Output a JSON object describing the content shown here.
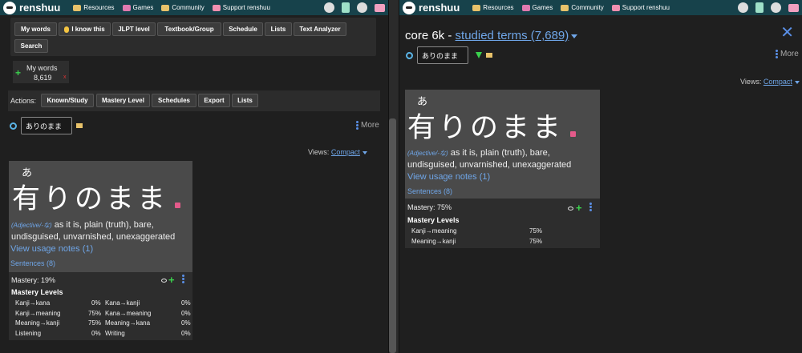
{
  "nav": {
    "brand": "renshuu",
    "links": [
      "Resources",
      "Games",
      "Community",
      "Support renshuu"
    ]
  },
  "left": {
    "toolbar": [
      "My words",
      "I know this",
      "JLPT level",
      "Textbook/Group",
      "Schedule",
      "Lists",
      "Text Analyzer",
      "Search"
    ],
    "mywords": {
      "label": "My words",
      "count": "8,619",
      "remove": "x"
    },
    "actions": {
      "label": "Actions:",
      "buttons": [
        "Known/Study",
        "Mastery Level",
        "Schedules",
        "Export",
        "Lists"
      ]
    },
    "search_value": "ありのまま",
    "more": "More",
    "views_label": "Views:",
    "views_value": "Compact",
    "card": {
      "furigana": "あ",
      "word": "有りのまま",
      "pos": "(Adjective/-な)",
      "definition": "as it is, plain (truth), bare, undisguised, unvarnished, unexaggerated",
      "usage": "View usage notes (1)",
      "sentences": "Sentences (8)",
      "mastery": "Mastery: 19%",
      "levels_title": "Mastery Levels",
      "levels": [
        {
          "name": "Kanji→kana",
          "value": "0%"
        },
        {
          "name": "Kana→kanji",
          "value": "0%"
        },
        {
          "name": "Kanji→meaning",
          "value": "75%"
        },
        {
          "name": "Kana→meaning",
          "value": "0%"
        },
        {
          "name": "Meaning→kanji",
          "value": "75%"
        },
        {
          "name": "Meaning→kana",
          "value": "0%"
        },
        {
          "name": "Listening",
          "value": "0%"
        },
        {
          "name": "Writing",
          "value": "0%"
        }
      ]
    }
  },
  "right": {
    "title_prefix": "core 6k -",
    "title_link": "studied terms (7,689)",
    "close": "✕",
    "search_value": "ありのまま",
    "more": "More",
    "views_label": "Views:",
    "views_value": "Compact",
    "card": {
      "furigana": "あ",
      "word": "有りのまま",
      "pos": "(Adjective/-な)",
      "definition": "as it is, plain (truth), bare, undisguised, unvarnished, unexaggerated",
      "usage": "View usage notes (1)",
      "sentences": "Sentences (8)",
      "mastery": "Mastery: 75%",
      "levels_title": "Mastery Levels",
      "levels": [
        {
          "name": "Kanji→meaning",
          "value": "75%"
        },
        {
          "name": "Meaning→kanji",
          "value": "75%"
        }
      ]
    }
  }
}
